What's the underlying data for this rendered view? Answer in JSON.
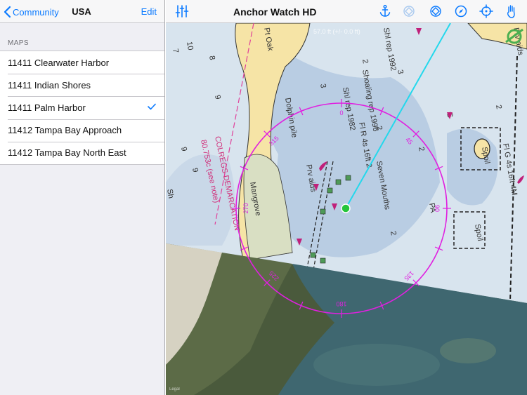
{
  "left_nav": {
    "back_label": "Community",
    "title": "USA",
    "edit_label": "Edit"
  },
  "maps_section": {
    "header": "MAPS",
    "items": [
      {
        "label": "11411 Clearwater Harbor",
        "selected": false
      },
      {
        "label": "11411 Indian Shores",
        "selected": false
      },
      {
        "label": "11411 Palm Harbor",
        "selected": true
      },
      {
        "label": "11412 Tampa Bay Approach",
        "selected": false
      },
      {
        "label": "11412 Tampa Bay North East",
        "selected": false
      }
    ]
  },
  "toolbar": {
    "title": "Anchor Watch HD",
    "left_icon": "sliders-icon",
    "right_icons": [
      "anchor-icon",
      "target-dim-icon",
      "target-diamond-icon",
      "compass-icon",
      "crosshair-icon",
      "hand-icon"
    ]
  },
  "map": {
    "scale_text": "57.0 ft (+/- 0.0 ft)",
    "compass_labels": [
      "0",
      "45",
      "90",
      "135",
      "180",
      "225",
      "270",
      "315"
    ],
    "chart_text": [
      "Shl rep 1992",
      "Shoaling rep 1996",
      "Shl rep 1982",
      "Fl R 4s 16ft 2",
      "Seven Mouths",
      "Mangrove",
      "Prv aids",
      "COLREGS DEMARCATION",
      "80.753c (see note)",
      "Fl G 4s 16ft 4M",
      "Spoil",
      "Pt Oak",
      "Dolphin pile",
      "Legal"
    ],
    "colors": {
      "water": "#d8e4ee",
      "shallow": "#b9cde3",
      "land": "#f6e4a6",
      "mangrove": "#d9dfc3",
      "ring": "#e020e0",
      "anchor_line": "#23d8ec",
      "position": "#25c53a"
    }
  }
}
